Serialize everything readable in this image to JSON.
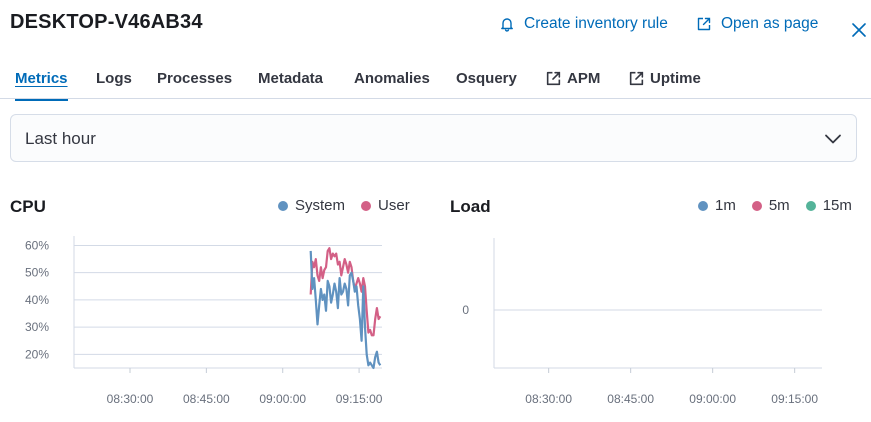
{
  "header": {
    "title": "DESKTOP-V46AB34",
    "create_rule_label": "Create inventory rule",
    "open_page_label": "Open as page"
  },
  "tabs": [
    {
      "label": "Metrics",
      "active": true,
      "external": false
    },
    {
      "label": "Logs",
      "active": false,
      "external": false
    },
    {
      "label": "Processes",
      "active": false,
      "external": false
    },
    {
      "label": "Metadata",
      "active": false,
      "external": false
    },
    {
      "label": "Anomalies",
      "active": false,
      "external": false
    },
    {
      "label": "Osquery",
      "active": false,
      "external": false
    },
    {
      "label": "APM",
      "active": false,
      "external": true
    },
    {
      "label": "Uptime",
      "active": false,
      "external": true
    }
  ],
  "time_range": {
    "value": "Last hour"
  },
  "colors": {
    "accent": "#006bb8",
    "system": "#6092c0",
    "user": "#d36086",
    "load_15m": "#54b399"
  },
  "chart_data": [
    {
      "type": "line",
      "title": "CPU",
      "x_ticks": [
        "08:30:00",
        "08:45:00",
        "09:00:00",
        "09:15:00"
      ],
      "y_ticks": [
        "60%",
        "50%",
        "40%",
        "30%",
        "20%"
      ],
      "ylim": [
        15,
        62
      ],
      "xlim": [
        "08:19:00",
        "09:19:30"
      ],
      "legend": "top-right",
      "grid": true,
      "series": [
        {
          "name": "System",
          "color": "#6092c0",
          "x": [
            "09:05:30",
            "09:05:50",
            "09:06:10",
            "09:06:30",
            "09:06:50",
            "09:07:10",
            "09:07:30",
            "09:07:50",
            "09:08:10",
            "09:08:30",
            "09:08:50",
            "09:09:10",
            "09:09:30",
            "09:09:50",
            "09:10:10",
            "09:10:30",
            "09:10:50",
            "09:11:10",
            "09:11:30",
            "09:11:50",
            "09:12:10",
            "09:12:30",
            "09:12:50",
            "09:13:10",
            "09:13:30",
            "09:13:50",
            "09:14:10",
            "09:14:30",
            "09:14:50",
            "09:15:10",
            "09:15:30",
            "09:15:50",
            "09:16:10",
            "09:16:30",
            "09:16:50",
            "09:17:10",
            "09:17:30",
            "09:17:50",
            "09:18:10",
            "09:18:30",
            "09:18:50",
            "09:19:10"
          ],
          "values": [
            58,
            44,
            48,
            40,
            31,
            38,
            44,
            40,
            42,
            36,
            47,
            45,
            39,
            42,
            46,
            43,
            37,
            48,
            42,
            43,
            46,
            44,
            38,
            49,
            50,
            47,
            43,
            45,
            38,
            33,
            25,
            45,
            30,
            20,
            16,
            17,
            16,
            15,
            19,
            21,
            17,
            16
          ]
        },
        {
          "name": "User",
          "color": "#d36086",
          "x": [
            "09:05:30",
            "09:05:50",
            "09:06:10",
            "09:06:30",
            "09:06:50",
            "09:07:10",
            "09:07:30",
            "09:07:50",
            "09:08:10",
            "09:08:30",
            "09:08:50",
            "09:09:10",
            "09:09:30",
            "09:09:50",
            "09:10:10",
            "09:10:30",
            "09:10:50",
            "09:11:10",
            "09:11:30",
            "09:11:50",
            "09:12:10",
            "09:12:30",
            "09:12:50",
            "09:13:10",
            "09:13:30",
            "09:13:50",
            "09:14:10",
            "09:14:30",
            "09:14:50",
            "09:15:10",
            "09:15:30",
            "09:15:50",
            "09:16:10",
            "09:16:30",
            "09:16:50",
            "09:17:10",
            "09:17:30",
            "09:17:50",
            "09:18:10",
            "09:18:30",
            "09:18:50",
            "09:19:10"
          ],
          "values": [
            42,
            54,
            52,
            55,
            49,
            47,
            52,
            48,
            51,
            52,
            58,
            59,
            55,
            57,
            56,
            57,
            53,
            54,
            49,
            52,
            55,
            53,
            50,
            54,
            52,
            47,
            44,
            46,
            48,
            46,
            43,
            48,
            45,
            36,
            28,
            29,
            27,
            27,
            33,
            37,
            33,
            34
          ]
        }
      ]
    },
    {
      "type": "line",
      "title": "Load",
      "x_ticks": [
        "08:30:00",
        "08:45:00",
        "09:00:00",
        "09:15:00"
      ],
      "y_ticks": [
        "0"
      ],
      "xlim": [
        "08:20:00",
        "09:20:00"
      ],
      "legend": "top-right",
      "grid": true,
      "series": [
        {
          "name": "1m",
          "color": "#6092c0",
          "values": []
        },
        {
          "name": "5m",
          "color": "#d36086",
          "values": []
        },
        {
          "name": "15m",
          "color": "#54b399",
          "values": []
        }
      ]
    }
  ]
}
